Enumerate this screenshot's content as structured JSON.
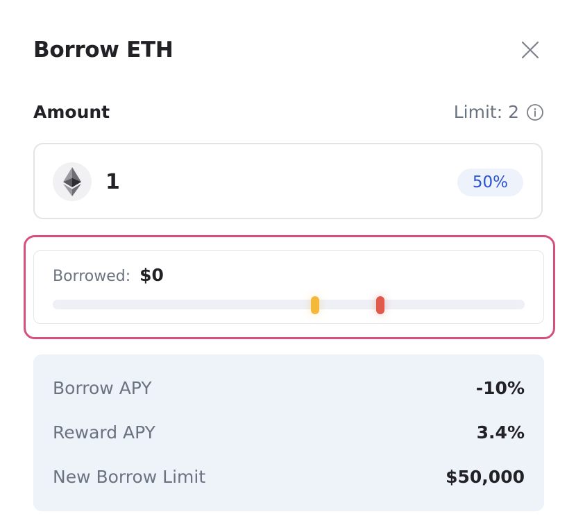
{
  "modal": {
    "title": "Borrow ETH"
  },
  "amount": {
    "label": "Amount",
    "limit_text": "Limit: 2",
    "value": "1",
    "token_icon": "ethereum-icon",
    "percent_badge": "50%"
  },
  "borrowed": {
    "label": "Borrowed:",
    "value": "$0",
    "bar_fill_fraction": 0.0
  },
  "stats": [
    {
      "label": "Borrow APY",
      "value": "-10%"
    },
    {
      "label": "Reward APY",
      "value": "3.4%"
    },
    {
      "label": "New Borrow Limit",
      "value": "$50,000"
    }
  ],
  "colors": {
    "accent_blue": "#2a52d4",
    "highlight_pink": "#d64f7e",
    "warning_marker": "#f4b93a",
    "danger_marker": "#df5a4a",
    "stats_background": "#eef2f9"
  }
}
